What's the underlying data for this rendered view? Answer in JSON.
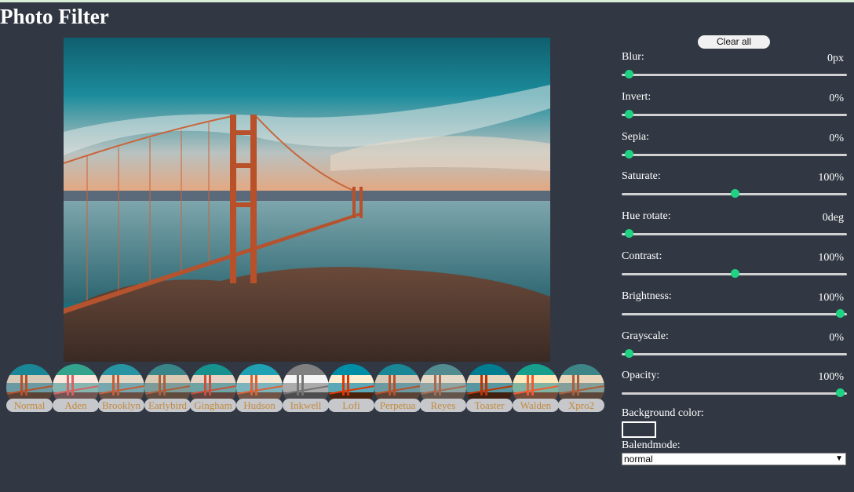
{
  "page": {
    "title": "Photo Filter"
  },
  "toolbar": {
    "clear_label": "Clear all"
  },
  "controls": [
    {
      "label": "Blur:",
      "value": "0px",
      "level": 0.0
    },
    {
      "label": "Invert:",
      "value": "0%",
      "level": 0.0
    },
    {
      "label": "Sepia:",
      "value": "0%",
      "level": 0.0
    },
    {
      "label": "Saturate:",
      "value": "100%",
      "level": 0.5
    },
    {
      "label": "Hue rotate:",
      "value": "0deg",
      "level": 0.0
    },
    {
      "label": "Contrast:",
      "value": "100%",
      "level": 0.5
    },
    {
      "label": "Brightness:",
      "value": "100%",
      "level": 1.0
    },
    {
      "label": "Grayscale:",
      "value": "0%",
      "level": 0.0
    },
    {
      "label": "Opacity:",
      "value": "100%",
      "level": 1.0
    }
  ],
  "background": {
    "label": "Background color:",
    "value": "#ffffff"
  },
  "blendmode": {
    "label": "Balendmode:",
    "value": "normal"
  },
  "filters": [
    {
      "label": "Normal",
      "css": "none"
    },
    {
      "label": "Aden",
      "css": "hue-rotate(-20deg) contrast(0.9) saturate(0.85) brightness(1.2)"
    },
    {
      "label": "Brooklyn",
      "css": "contrast(0.9) brightness(1.1)"
    },
    {
      "label": "Earlybird",
      "css": "contrast(0.9) sepia(0.2)"
    },
    {
      "label": "Gingham",
      "css": "brightness(1.05) hue-rotate(-10deg)"
    },
    {
      "label": "Hudson",
      "css": "brightness(1.2) contrast(0.9) saturate(1.1)"
    },
    {
      "label": "Inkwell",
      "css": "sepia(0.3) contrast(1.1) brightness(1.1) grayscale(1)"
    },
    {
      "label": "Lofi",
      "css": "saturate(1.1) contrast(1.5)"
    },
    {
      "label": "Perpetua",
      "css": "none"
    },
    {
      "label": "Reyes",
      "css": "sepia(0.22) brightness(1.1) contrast(0.85) saturate(0.75)"
    },
    {
      "label": "Toaster",
      "css": "contrast(1.5) brightness(0.9)"
    },
    {
      "label": "Walden",
      "css": "brightness(1.1) hue-rotate(-10deg) sepia(0.3) saturate(1.6)"
    },
    {
      "label": "Xpro2",
      "css": "sepia(0.3)"
    }
  ],
  "colors": {
    "accent": "#1fd385",
    "background": "#323843",
    "thumb_label": "#c48a3c"
  }
}
